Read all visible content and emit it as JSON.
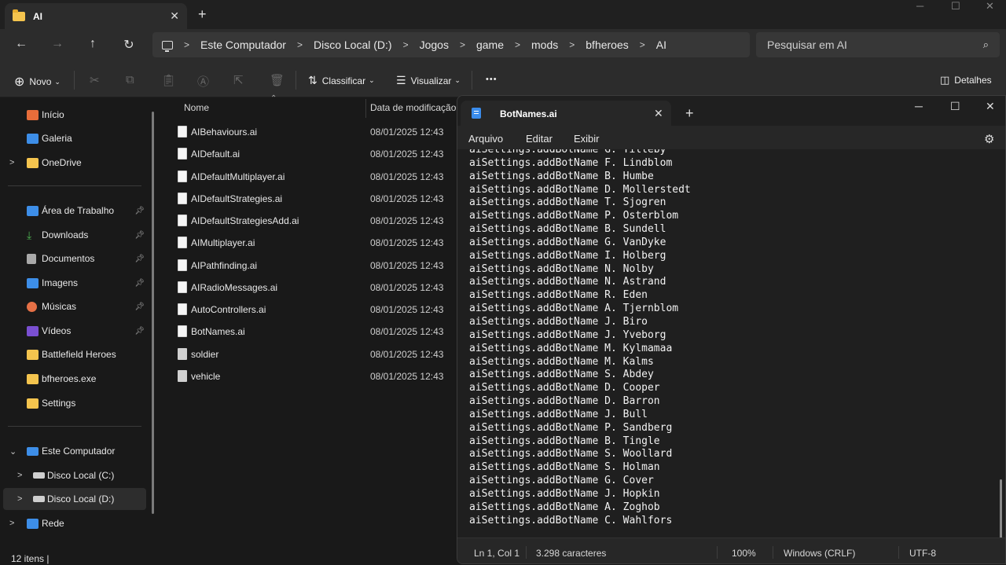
{
  "explorer": {
    "tab_title": "AI",
    "tab_close": "✕",
    "new_tab": "+",
    "window_controls": [
      "─",
      "☐",
      "✕"
    ],
    "nav": {
      "back": "←",
      "forward": "→",
      "up": "↑",
      "refresh": "↻"
    },
    "breadcrumb": [
      "Este Computador",
      "Disco Local (D:)",
      "Jogos",
      "game",
      "mods",
      "bfheroes",
      "AI"
    ],
    "search_placeholder": "Pesquisar em AI",
    "toolbar": {
      "new_label": "Novo",
      "sort_label": "Classificar",
      "view_label": "Visualizar",
      "more_label": "•••",
      "details_label": "Detalhes"
    },
    "sidebar": {
      "top": [
        {
          "label": "Início",
          "icon": "home-icon"
        },
        {
          "label": "Galeria",
          "icon": "gallery-icon"
        },
        {
          "label": "OneDrive",
          "icon": "folder-icon"
        }
      ],
      "quick": [
        {
          "label": "Área de Trabalho",
          "icon": "desktop-icon"
        },
        {
          "label": "Downloads",
          "icon": "download-icon"
        },
        {
          "label": "Documentos",
          "icon": "documents-icon"
        },
        {
          "label": "Imagens",
          "icon": "images-icon"
        },
        {
          "label": "Músicas",
          "icon": "music-icon"
        },
        {
          "label": "Vídeos",
          "icon": "videos-icon"
        },
        {
          "label": "Battlefield Heroes",
          "icon": "folder-icon"
        },
        {
          "label": "bfheroes.exe",
          "icon": "folder-icon"
        },
        {
          "label": "Settings",
          "icon": "folder-icon"
        }
      ],
      "this_pc": "Este Computador",
      "drive_c": "Disco Local (C:)",
      "drive_d": "Disco Local (D:)",
      "network": "Rede"
    },
    "columns": {
      "name": "Nome",
      "date": "Data de modificação"
    },
    "files": [
      {
        "name": "AIBehaviours.ai",
        "date": "08/01/2025 12:43"
      },
      {
        "name": "AIDefault.ai",
        "date": "08/01/2025 12:43"
      },
      {
        "name": "AIDefaultMultiplayer.ai",
        "date": "08/01/2025 12:43"
      },
      {
        "name": "AIDefaultStrategies.ai",
        "date": "08/01/2025 12:43"
      },
      {
        "name": "AIDefaultStrategiesAdd.ai",
        "date": "08/01/2025 12:43"
      },
      {
        "name": "AIMultiplayer.ai",
        "date": "08/01/2025 12:43"
      },
      {
        "name": "AIPathfinding.ai",
        "date": "08/01/2025 12:43"
      },
      {
        "name": "AIRadioMessages.ai",
        "date": "08/01/2025 12:43"
      },
      {
        "name": "AutoControllers.ai",
        "date": "08/01/2025 12:43"
      },
      {
        "name": "BotNames.ai",
        "date": "08/01/2025 12:43"
      },
      {
        "name": "soldier",
        "date": "08/01/2025 12:43"
      },
      {
        "name": "vehicle",
        "date": "08/01/2025 12:43"
      }
    ],
    "status": "12 itens  |"
  },
  "notepad": {
    "tab_title": "BotNames.ai",
    "menu": [
      "Arquivo",
      "Editar",
      "Exibir"
    ],
    "lines": [
      "aiSettings.addBotName G. Tilleby",
      "aiSettings.addBotName F. Lindblom",
      "aiSettings.addBotName B. Humbe",
      "aiSettings.addBotName D. Mollerstedt",
      "aiSettings.addBotName T. Sjogren",
      "aiSettings.addBotName P. Osterblom",
      "aiSettings.addBotName B. Sundell",
      "aiSettings.addBotName G. VanDyke",
      "aiSettings.addBotName I. Holberg",
      "aiSettings.addBotName N. Nolby",
      "aiSettings.addBotName N. Astrand",
      "aiSettings.addBotName R. Eden",
      "aiSettings.addBotName A. Tjernblom",
      "aiSettings.addBotName J. Biro",
      "aiSettings.addBotName J. Yveborg",
      "aiSettings.addBotName M. Kylmamaa",
      "aiSettings.addBotName M. Kalms",
      "aiSettings.addBotName S. Abdey",
      "aiSettings.addBotName D. Cooper",
      "aiSettings.addBotName D. Barron",
      "aiSettings.addBotName J. Bull",
      "aiSettings.addBotName P. Sandberg",
      "aiSettings.addBotName B. Tingle",
      "aiSettings.addBotName S. Woollard",
      "aiSettings.addBotName S. Holman",
      "aiSettings.addBotName G. Cover",
      "aiSettings.addBotName J. Hopkin",
      "aiSettings.addBotName A. Zoghob",
      "aiSettings.addBotName C. Wahlfors"
    ],
    "status": {
      "position": "Ln 1, Col 1",
      "chars": "3.298 caracteres",
      "zoom": "100%",
      "line_ending": "Windows (CRLF)",
      "encoding": "UTF-8"
    }
  }
}
